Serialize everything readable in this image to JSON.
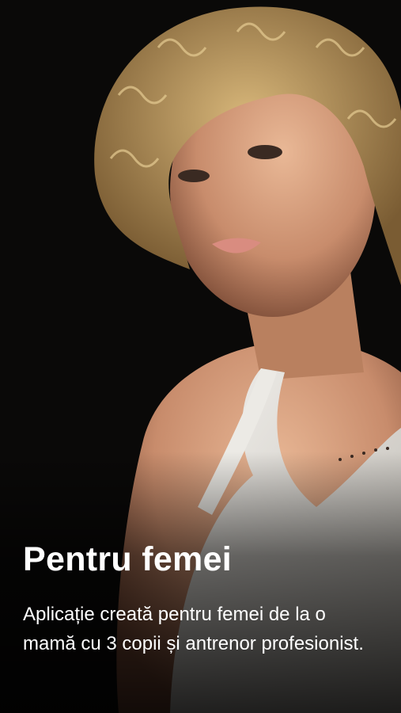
{
  "onboarding": {
    "title": "Pentru femei",
    "description": "Aplicație creată pentru femei de la o mamă cu 3 copii și antrenor profesionist."
  },
  "image": {
    "subject": "woman-portrait"
  },
  "colors": {
    "background": "#0a0908",
    "text": "#ffffff",
    "hair": "#b8955e",
    "skin": "#d9a07f",
    "tank_top": "#e9e7e2"
  }
}
